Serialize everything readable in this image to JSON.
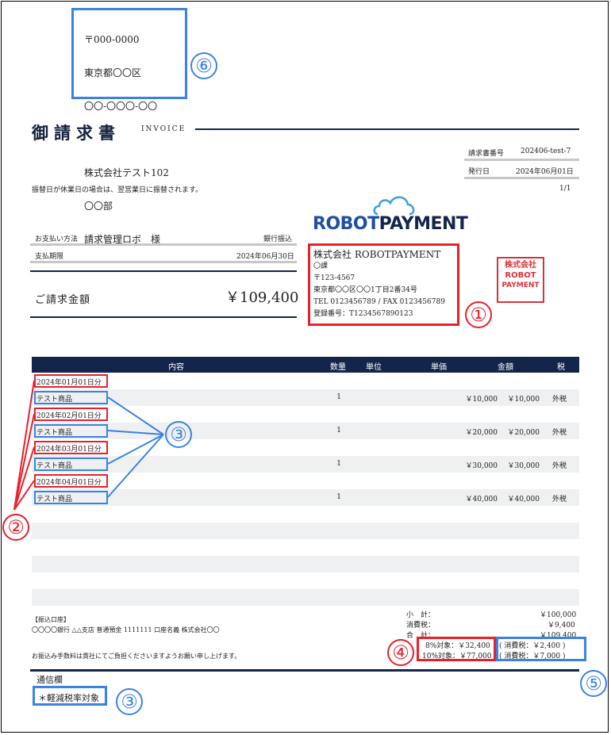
{
  "recipient": {
    "postal": "〒000-0000",
    "address1": "東京都〇〇区",
    "address2": "〇〇-〇〇〇-〇〇",
    "company": "株式会社テスト102",
    "dept": "〇〇部",
    "person": "請求管理ロボ　様"
  },
  "header": {
    "title": "御請求書",
    "subtitle": "INVOICE",
    "invoice_no_label": "請求書番号",
    "invoice_no": "202406-test-7",
    "issue_label": "発行日",
    "issue_date": "2024年06月01日",
    "page": "1/1"
  },
  "notice": "振替日が休業日の場合は、翌営業日に振替されます。",
  "payment": {
    "method_label": "お支払い方法",
    "method": "銀行振込",
    "due_label": "支払期限",
    "due": "2024年06月30日",
    "amount_label": "ご請求金額",
    "amount": "￥109,400"
  },
  "issuer": {
    "logo_left": "ROBOT",
    "logo_right": "PAYMENT",
    "name": "株式会社 ROBOTPAYMENT",
    "section": "〇課",
    "postal": "〒123-4567",
    "address": "東京都〇〇区〇〇1丁目2番34号",
    "tel": "TEL 0123456789 / FAX 0123456789",
    "reg": "登録番号：T1234567890123",
    "stamp_lines": [
      "株式会社",
      "ROBOT",
      "PAYMENT"
    ]
  },
  "table": {
    "headers": [
      "内容",
      "数量",
      "単位",
      "単価",
      "金額",
      "税"
    ],
    "rows": [
      {
        "content": "2024年01月01日分",
        "qty": "",
        "unit": "",
        "price": "",
        "amount": "",
        "tax": ""
      },
      {
        "content": "テスト商品",
        "qty": "1",
        "unit": "",
        "price": "￥10,000",
        "amount": "￥10,000",
        "tax": "外税"
      },
      {
        "content": "2024年02月01日分",
        "qty": "",
        "unit": "",
        "price": "",
        "amount": "",
        "tax": ""
      },
      {
        "content": "テスト商品",
        "qty": "1",
        "unit": "",
        "price": "￥20,000",
        "amount": "￥20,000",
        "tax": "外税"
      },
      {
        "content": "2024年03月01日分",
        "qty": "",
        "unit": "",
        "price": "",
        "amount": "",
        "tax": ""
      },
      {
        "content": "テスト商品",
        "qty": "1",
        "unit": "",
        "price": "￥30,000",
        "amount": "￥30,000",
        "tax": "外税"
      },
      {
        "content": "2024年04月01日分",
        "qty": "",
        "unit": "",
        "price": "",
        "amount": "",
        "tax": ""
      },
      {
        "content": "テスト商品",
        "qty": "1",
        "unit": "",
        "price": "￥40,000",
        "amount": "￥40,000",
        "tax": "外税"
      }
    ]
  },
  "bank": {
    "label": "【振込口座】",
    "detail": "〇〇〇〇銀行 △△支店 普通預金 1111111 口座名義 株式会社〇〇",
    "fee_note": "お振込み手数料は貴社にてご負担くださいますようお願い申し上げます。"
  },
  "totals": {
    "subtotal_label": "小　計：",
    "subtotal": "￥100,000",
    "tax_label": "消費税：",
    "tax": "￥9,400",
    "total_label": "合　計：",
    "total": "￥109,400",
    "t8": "8%対象：￥32,400",
    "t10": "10%対象：￥77,000",
    "tax8": "( 消費税：￥2,400 )",
    "tax10": "( 消費税：￥7,000 )"
  },
  "memo": {
    "label": "通信欄",
    "text": "＊軽減税率対象"
  },
  "annotations": [
    "①",
    "②",
    "③",
    "④",
    "⑤",
    "⑥"
  ]
}
